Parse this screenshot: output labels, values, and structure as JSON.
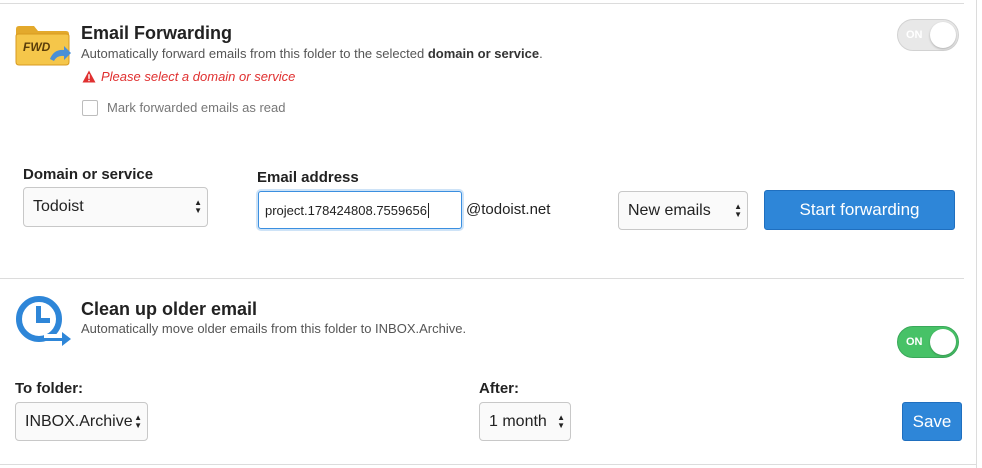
{
  "forwarding": {
    "icon_label": "FWD",
    "title": "Email Forwarding",
    "description_prefix": "Automatically forward emails from this folder to the selected ",
    "description_bold": "domain or service",
    "description_suffix": ".",
    "toggle_label": "ON",
    "toggle_state": "off",
    "warning": "Please select a domain or service",
    "mark_read_label": "Mark forwarded emails as read",
    "domain_label": "Domain or service",
    "domain_value": "Todoist",
    "email_label": "Email address",
    "email_value": "project.178424808.7559656",
    "email_suffix": "@todoist.net",
    "filter_value": "New emails",
    "start_button": "Start forwarding"
  },
  "cleanup": {
    "title": "Clean up older email",
    "description": "Automatically move older emails from this folder to INBOX.Archive.",
    "toggle_label": "ON",
    "toggle_state": "on",
    "to_folder_label": "To folder:",
    "to_folder_value": "INBOX.Archive",
    "after_label": "After:",
    "after_value": "1 month",
    "save_button": "Save"
  },
  "colors": {
    "accent": "#2e86d8",
    "toggle_on": "#47c267",
    "warning": "#e03030",
    "folder_icon": "#f5c64a",
    "clock_icon": "#2e86d8"
  }
}
